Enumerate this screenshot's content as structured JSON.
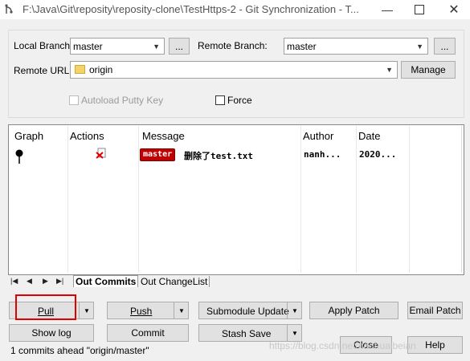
{
  "window": {
    "title": "F:\\Java\\Git\\reposity\\reposity-clone\\TestHttps-2 - Git Synchronization - T..."
  },
  "form": {
    "local_branch_label": "Local Branch:",
    "local_branch_value": "master",
    "remote_branch_label": "Remote Branch:",
    "remote_branch_value": "master",
    "browse_label": "...",
    "remote_url_label": "Remote URL:",
    "remote_url_value": "origin",
    "manage_label": "Manage",
    "autoload_label": "Autoload Putty Key",
    "force_label": "Force"
  },
  "grid": {
    "headers": [
      "Graph",
      "Actions",
      "Message",
      "Author",
      "Date"
    ],
    "rows": [
      {
        "tag": "master",
        "message": "删除了test.txt",
        "author": "nanh...",
        "date": "2020..."
      }
    ]
  },
  "tabs": {
    "nav": [
      "|◀",
      "◀",
      "▶",
      "▶|"
    ],
    "items": [
      "Out Commits",
      "Out ChangeList"
    ]
  },
  "buttons": {
    "pull": "Pull",
    "push": "Push",
    "submodule_update": "Submodule Update",
    "apply_patch": "Apply Patch",
    "email_patch": "Email Patch",
    "show_log": "Show log",
    "commit": "Commit",
    "stash_save": "Stash Save",
    "close": "Close",
    "help": "Help"
  },
  "status": {
    "text": "1 commits ahead \"origin/master\""
  },
  "watermark": "https://blog.csdn.net/nanhuaibeian",
  "colors": {
    "tag_bg": "#c00000",
    "highlight": "#e00000",
    "folder": "#f5d36b"
  }
}
